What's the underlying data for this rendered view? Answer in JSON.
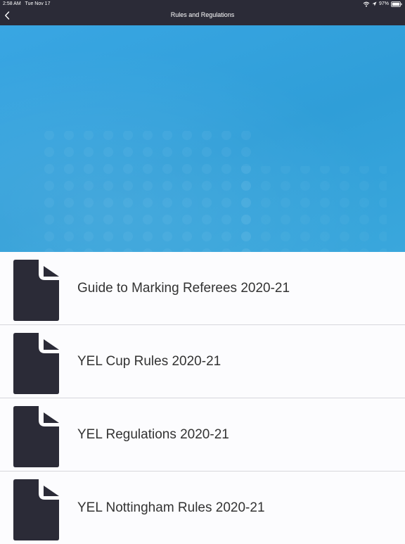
{
  "status_bar": {
    "time": "2:58 AM",
    "date": "Tue Nov 17",
    "battery": "97%",
    "icons": [
      "wifi-icon",
      "location-icon",
      "battery-icon"
    ]
  },
  "nav": {
    "title": "Rules and Regulations",
    "back_icon": "chevron-left-icon"
  },
  "colors": {
    "nav_background": "#2b2b37",
    "hero_blue": "#2f9ed8",
    "document_icon": "#2b2b37"
  },
  "documents": [
    {
      "label": "Guide to Marking Referees 2020-21",
      "icon": "document-icon"
    },
    {
      "label": "YEL Cup Rules 2020-21",
      "icon": "document-icon"
    },
    {
      "label": "YEL Regulations 2020-21",
      "icon": "document-icon"
    },
    {
      "label": "YEL Nottingham Rules 2020-21",
      "icon": "document-icon"
    }
  ]
}
